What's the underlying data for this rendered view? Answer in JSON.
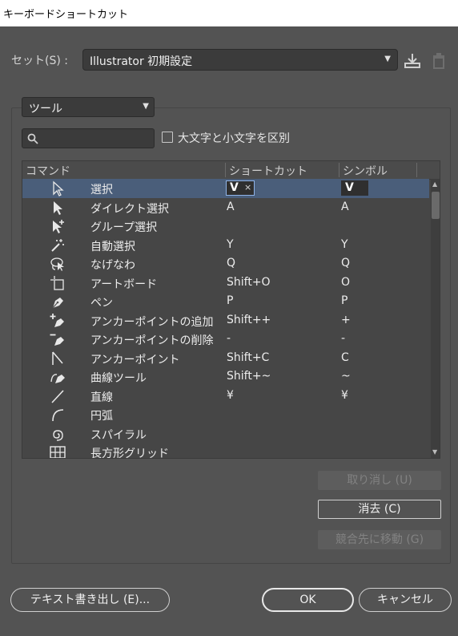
{
  "window": {
    "title": "キーボードショートカット"
  },
  "set": {
    "label": "セット(S) :",
    "value": "Illustrator 初期設定"
  },
  "icons": {
    "save": "download-icon",
    "delete": "trash-icon"
  },
  "category": {
    "value": "ツール"
  },
  "search": {
    "placeholder": "",
    "value": ""
  },
  "case_checkbox": {
    "label": "大文字と小文字を区別",
    "checked": false
  },
  "table": {
    "headers": {
      "command": "コマンド",
      "shortcut": "ショートカット",
      "symbol": "シンボル"
    },
    "rows": [
      {
        "icon": "selection-arrow-icon",
        "command": "選択",
        "shortcut": "V",
        "symbol": "V",
        "selected": true
      },
      {
        "icon": "direct-selection-arrow-icon",
        "command": "ダイレクト選択",
        "shortcut": "A",
        "symbol": "A"
      },
      {
        "icon": "group-selection-arrow-icon",
        "command": "グループ選択",
        "shortcut": "",
        "symbol": ""
      },
      {
        "icon": "magic-wand-icon",
        "command": "自動選択",
        "shortcut": "Y",
        "symbol": "Y"
      },
      {
        "icon": "lasso-icon",
        "command": "なげなわ",
        "shortcut": "Q",
        "symbol": "Q"
      },
      {
        "icon": "artboard-icon",
        "command": "アートボード",
        "shortcut": "Shift+O",
        "symbol": "O"
      },
      {
        "icon": "pen-icon",
        "command": "ペン",
        "shortcut": "P",
        "symbol": "P"
      },
      {
        "icon": "add-anchor-point-icon",
        "command": "アンカーポイントの追加",
        "shortcut": "Shift++",
        "symbol": "+"
      },
      {
        "icon": "delete-anchor-point-icon",
        "command": "アンカーポイントの削除",
        "shortcut": "-",
        "symbol": "-"
      },
      {
        "icon": "anchor-point-icon",
        "command": "アンカーポイント",
        "shortcut": "Shift+C",
        "symbol": "C"
      },
      {
        "icon": "curvature-icon",
        "command": "曲線ツール",
        "shortcut": "Shift+~",
        "symbol": "~"
      },
      {
        "icon": "line-segment-icon",
        "command": "直線",
        "shortcut": "¥",
        "symbol": "¥"
      },
      {
        "icon": "arc-icon",
        "command": "円弧",
        "shortcut": "",
        "symbol": ""
      },
      {
        "icon": "spiral-icon",
        "command": "スパイラル",
        "shortcut": "",
        "symbol": ""
      },
      {
        "icon": "rectangular-grid-icon",
        "command": "長方形グリッド",
        "shortcut": "",
        "symbol": ""
      }
    ],
    "edit_remove_glyph": "×"
  },
  "buttons": {
    "undo": "取り消し (U)",
    "clear": "消去 (C)",
    "goto_conflict": "競合先に移動 (G)",
    "export_text": "テキスト書き出し (E)...",
    "ok": "OK",
    "cancel": "キャンセル"
  },
  "colors": {
    "background": "#535353",
    "selection": "#4a5e7a",
    "field": "#3b3b3b"
  }
}
